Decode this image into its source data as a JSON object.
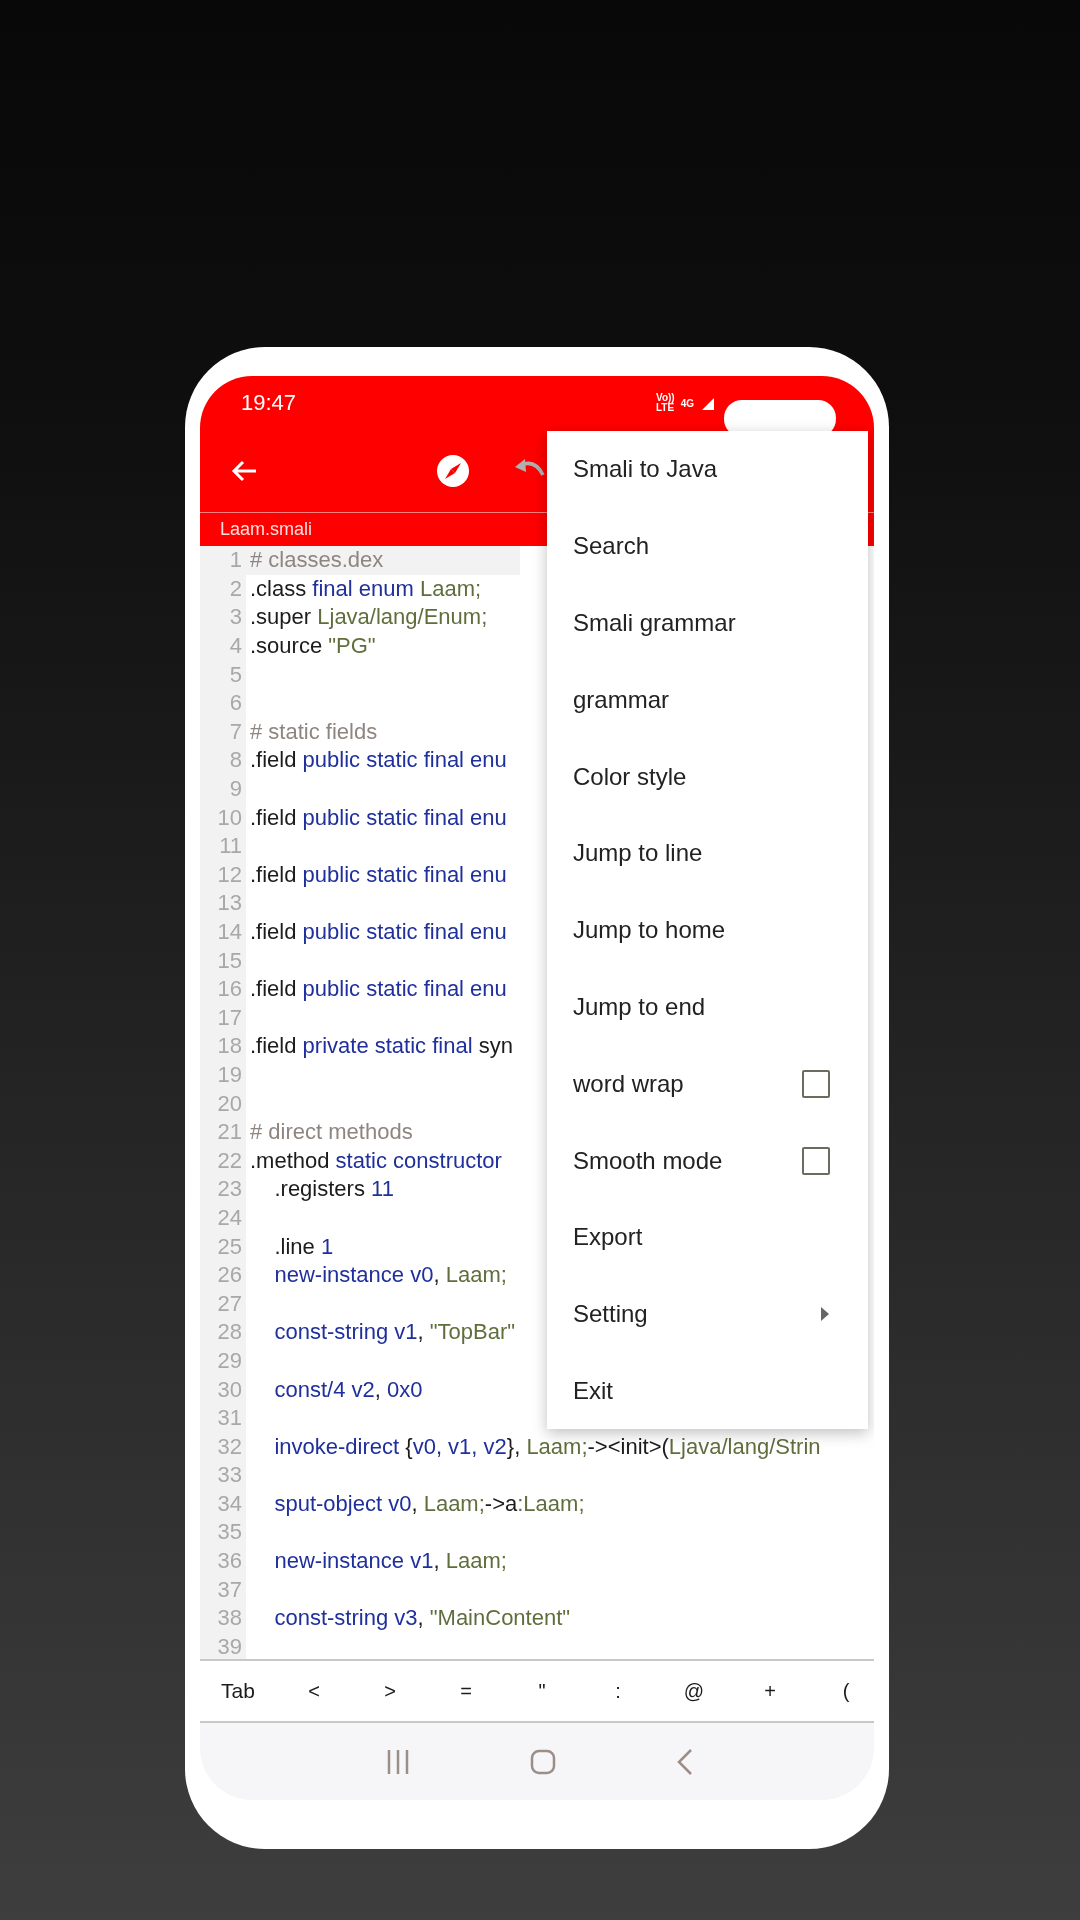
{
  "status_bar": {
    "time": "19:47",
    "volte_top": "Vo))",
    "volte_bottom": "LTE",
    "network": "4G"
  },
  "toolbar": {
    "tab_title": "Laam.smali"
  },
  "code_lines": [
    {
      "number": "1",
      "current": true,
      "tokens": [
        {
          "text": "# classes.dex",
          "kind": "comment"
        }
      ]
    },
    {
      "number": "2",
      "current": false,
      "tokens": [
        {
          "text": ".class ",
          "kind": "plain"
        },
        {
          "text": "final enum ",
          "kind": "keyword"
        },
        {
          "text": "Laam;",
          "kind": "type"
        }
      ]
    },
    {
      "number": "3",
      "current": false,
      "tokens": [
        {
          "text": ".super ",
          "kind": "plain"
        },
        {
          "text": "Ljava/lang/Enum;",
          "kind": "type"
        }
      ]
    },
    {
      "number": "4",
      "current": false,
      "tokens": [
        {
          "text": ".source ",
          "kind": "plain"
        },
        {
          "text": "\"PG\"",
          "kind": "type"
        }
      ]
    },
    {
      "number": "5",
      "current": false
    },
    {
      "number": "6",
      "current": false
    },
    {
      "number": "7",
      "current": false,
      "tokens": [
        {
          "text": "# static fields",
          "kind": "comment"
        }
      ]
    },
    {
      "number": "8",
      "current": false,
      "tokens": [
        {
          "text": ".field ",
          "kind": "plain"
        },
        {
          "text": "public static final enu",
          "kind": "keyword"
        }
      ]
    },
    {
      "number": "9",
      "current": false
    },
    {
      "number": "10",
      "current": false,
      "tokens": [
        {
          "text": ".field ",
          "kind": "plain"
        },
        {
          "text": "public static final enu",
          "kind": "keyword"
        }
      ]
    },
    {
      "number": "11",
      "current": false
    },
    {
      "number": "12",
      "current": false,
      "tokens": [
        {
          "text": ".field ",
          "kind": "plain"
        },
        {
          "text": "public static final enu",
          "kind": "keyword"
        }
      ]
    },
    {
      "number": "13",
      "current": false
    },
    {
      "number": "14",
      "current": false,
      "tokens": [
        {
          "text": ".field ",
          "kind": "plain"
        },
        {
          "text": "public static final enu",
          "kind": "keyword"
        }
      ]
    },
    {
      "number": "15",
      "current": false
    },
    {
      "number": "16",
      "current": false,
      "tokens": [
        {
          "text": ".field ",
          "kind": "plain"
        },
        {
          "text": "public static final enu",
          "kind": "keyword"
        }
      ]
    },
    {
      "number": "17",
      "current": false
    },
    {
      "number": "18",
      "current": false,
      "tokens": [
        {
          "text": ".field ",
          "kind": "plain"
        },
        {
          "text": "private static final ",
          "kind": "keyword"
        },
        {
          "text": "syn",
          "kind": "plain"
        }
      ]
    },
    {
      "number": "19",
      "current": false
    },
    {
      "number": "20",
      "current": false
    },
    {
      "number": "21",
      "current": false,
      "tokens": [
        {
          "text": "# direct methods",
          "kind": "comment"
        }
      ]
    },
    {
      "number": "22",
      "current": false,
      "tokens": [
        {
          "text": ".method ",
          "kind": "plain"
        },
        {
          "text": "static constructor",
          "kind": "keyword"
        }
      ]
    },
    {
      "number": "23",
      "current": false,
      "tokens": [
        {
          "text": "    .registers ",
          "kind": "plain"
        },
        {
          "text": "11",
          "kind": "keyword"
        }
      ]
    },
    {
      "number": "24",
      "current": false
    },
    {
      "number": "25",
      "current": false,
      "tokens": [
        {
          "text": "    .line ",
          "kind": "plain"
        },
        {
          "text": "1",
          "kind": "keyword"
        }
      ]
    },
    {
      "number": "26",
      "current": false,
      "tokens": [
        {
          "text": "    new-instance v0",
          "kind": "keyword"
        },
        {
          "text": ", ",
          "kind": "plain"
        },
        {
          "text": "Laam;",
          "kind": "type"
        }
      ]
    },
    {
      "number": "27",
      "current": false
    },
    {
      "number": "28",
      "current": false,
      "tokens": [
        {
          "text": "    const-string v1",
          "kind": "keyword"
        },
        {
          "text": ", ",
          "kind": "plain"
        },
        {
          "text": "\"TopBar\"",
          "kind": "type"
        }
      ]
    },
    {
      "number": "29",
      "current": false
    },
    {
      "number": "30",
      "current": false,
      "tokens": [
        {
          "text": "    const/4 v2",
          "kind": "keyword"
        },
        {
          "text": ", ",
          "kind": "plain"
        },
        {
          "text": "0x0",
          "kind": "keyword"
        }
      ]
    },
    {
      "number": "31",
      "current": false
    },
    {
      "number": "32",
      "current": false,
      "tokens": [
        {
          "text": "    invoke-direct ",
          "kind": "keyword"
        },
        {
          "text": "{",
          "kind": "plain"
        },
        {
          "text": "v0, v1, v2",
          "kind": "keyword"
        },
        {
          "text": "}, ",
          "kind": "plain"
        },
        {
          "text": "Laam;",
          "kind": "type"
        },
        {
          "text": "-><init>(",
          "kind": "plain"
        },
        {
          "text": "Ljava/lang/Strin",
          "kind": "type"
        }
      ]
    },
    {
      "number": "33",
      "current": false
    },
    {
      "number": "34",
      "current": false,
      "tokens": [
        {
          "text": "    sput-object v0",
          "kind": "keyword"
        },
        {
          "text": ", ",
          "kind": "plain"
        },
        {
          "text": "Laam;",
          "kind": "type"
        },
        {
          "text": "->a",
          "kind": "plain"
        },
        {
          "text": ":Laam;",
          "kind": "type"
        }
      ]
    },
    {
      "number": "35",
      "current": false
    },
    {
      "number": "36",
      "current": false,
      "tokens": [
        {
          "text": "    new-instance v1",
          "kind": "keyword"
        },
        {
          "text": ", ",
          "kind": "plain"
        },
        {
          "text": "Laam;",
          "kind": "type"
        }
      ]
    },
    {
      "number": "37",
      "current": false
    },
    {
      "number": "38",
      "current": false,
      "tokens": [
        {
          "text": "    const-string v3",
          "kind": "keyword"
        },
        {
          "text": ", ",
          "kind": "plain"
        },
        {
          "text": "\"MainContent\"",
          "kind": "type"
        }
      ]
    },
    {
      "number": "39",
      "current": false
    }
  ],
  "menu": [
    {
      "label": "Smali to Java",
      "kind": "plain"
    },
    {
      "label": "Search",
      "kind": "plain"
    },
    {
      "label": "Smali grammar",
      "kind": "plain"
    },
    {
      "label": "grammar",
      "kind": "plain"
    },
    {
      "label": "Color style",
      "kind": "plain"
    },
    {
      "label": "Jump to line",
      "kind": "plain"
    },
    {
      "label": "Jump to home",
      "kind": "plain"
    },
    {
      "label": "Jump to end",
      "kind": "plain"
    },
    {
      "label": "word wrap",
      "kind": "checkbox",
      "checked": false
    },
    {
      "label": "Smooth mode",
      "kind": "checkbox",
      "checked": false
    },
    {
      "label": "Export",
      "kind": "plain"
    },
    {
      "label": "Setting",
      "kind": "submenu"
    },
    {
      "label": "Exit",
      "kind": "plain"
    }
  ],
  "symbol_keys": [
    "Tab",
    "<",
    ">",
    "=",
    "\"",
    ":",
    "@",
    "+",
    "("
  ]
}
